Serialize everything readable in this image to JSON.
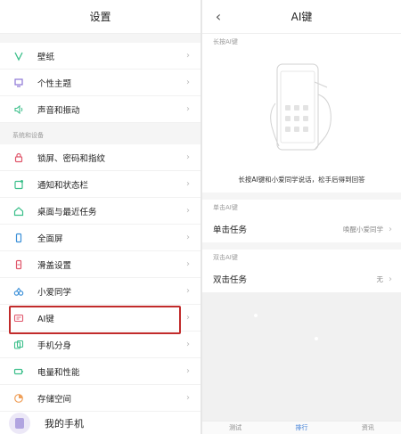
{
  "left": {
    "title": "设置",
    "group1": [
      {
        "label": "壁纸",
        "icon": "wallpaper-icon"
      },
      {
        "label": "个性主题",
        "icon": "theme-icon"
      },
      {
        "label": "声音和振动",
        "icon": "sound-icon"
      }
    ],
    "section_label": "系统和设备",
    "group2": [
      {
        "label": "锁屏、密码和指纹",
        "icon": "lock-icon"
      },
      {
        "label": "通知和状态栏",
        "icon": "notification-icon"
      },
      {
        "label": "桌面与最近任务",
        "icon": "home-icon"
      },
      {
        "label": "全面屏",
        "icon": "fullscreen-icon"
      },
      {
        "label": "滑盖设置",
        "icon": "slider-icon"
      },
      {
        "label": "小爱同学",
        "icon": "assistant-icon"
      },
      {
        "label": "AI键",
        "icon": "ai-key-icon"
      },
      {
        "label": "手机分身",
        "icon": "dual-space-icon"
      },
      {
        "label": "电量和性能",
        "icon": "battery-icon"
      },
      {
        "label": "存储空间",
        "icon": "storage-icon"
      }
    ],
    "my_device": "我的手机"
  },
  "right": {
    "title": "AI键",
    "long_press_head": "长按AI键",
    "long_press_caption": "长按AI键和小爱同学说话，松手后得到回答",
    "single_head": "单击AI键",
    "single_label": "单击任务",
    "single_value": "唤醒小爱同学",
    "double_head": "双击AI键",
    "double_label": "双击任务",
    "double_value": "无",
    "tabs": [
      "测试",
      "排行",
      "资讯"
    ]
  },
  "colors": {
    "highlight": "#c12b2b",
    "icon_green": "#3bbf8a",
    "icon_purple": "#8b74d6",
    "icon_blue": "#3a8fd8",
    "icon_red": "#e0566a",
    "icon_orange": "#f0a05a"
  }
}
